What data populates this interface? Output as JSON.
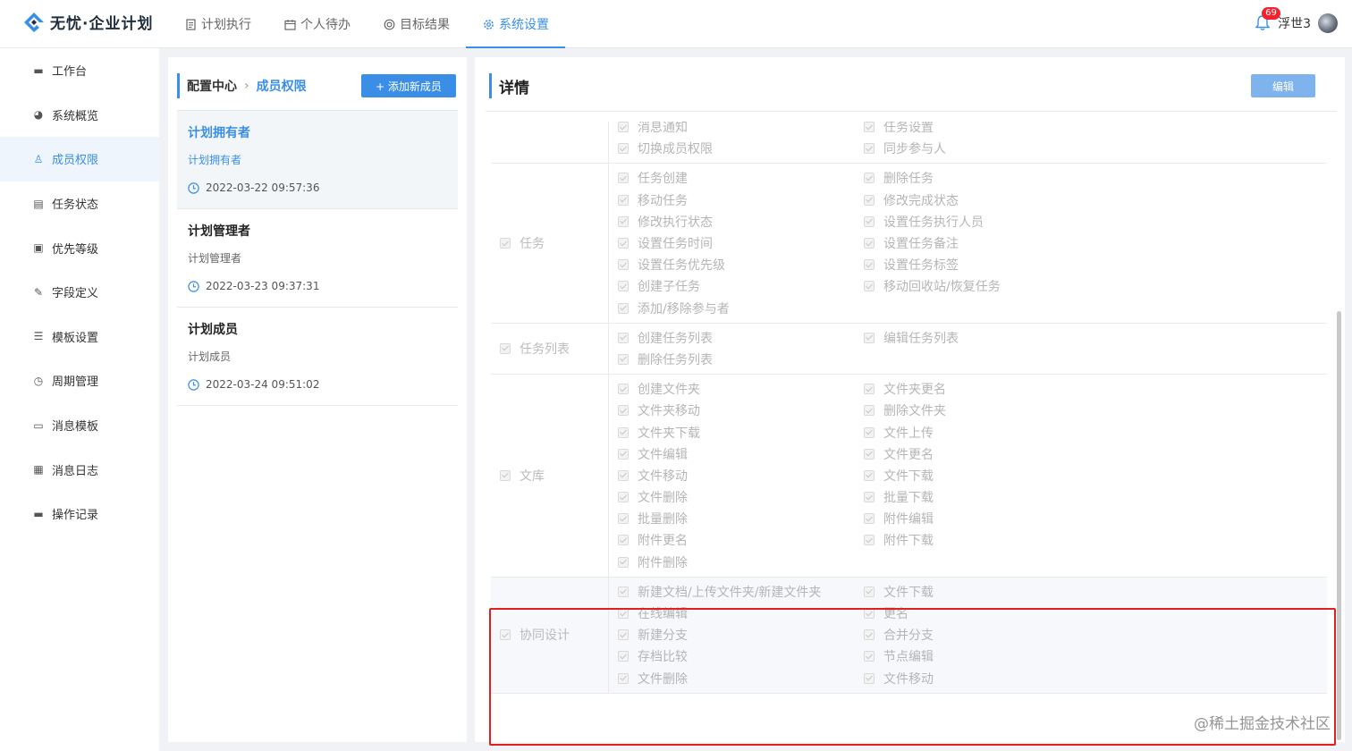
{
  "app": {
    "title": "无忧·企业计划",
    "logo_icon": "diamond-logo-icon"
  },
  "nav": [
    {
      "label": "计划执行",
      "icon": "document-icon",
      "active": false
    },
    {
      "label": "个人待办",
      "icon": "calendar-icon",
      "active": false
    },
    {
      "label": "目标结果",
      "icon": "target-icon",
      "active": false
    },
    {
      "label": "系统设置",
      "icon": "gear-icon",
      "active": true
    }
  ],
  "user": {
    "notification_count": "69",
    "name": "浮世3"
  },
  "sidebar": {
    "items": [
      {
        "label": "工作台",
        "icon": "monitor-icon",
        "glyph": "▬",
        "active": false
      },
      {
        "label": "系统概览",
        "icon": "palette-icon",
        "glyph": "◕",
        "active": false
      },
      {
        "label": "成员权限",
        "icon": "users-icon",
        "glyph": "♙",
        "active": true
      },
      {
        "label": "任务状态",
        "icon": "task-icon",
        "glyph": "▤",
        "active": false
      },
      {
        "label": "优先等级",
        "icon": "calendar-check-icon",
        "glyph": "▣",
        "active": false
      },
      {
        "label": "字段定义",
        "icon": "pen-icon",
        "glyph": "✎",
        "active": false
      },
      {
        "label": "模板设置",
        "icon": "list-icon",
        "glyph": "☰",
        "active": false
      },
      {
        "label": "周期管理",
        "icon": "clock-icon",
        "glyph": "◷",
        "active": false
      },
      {
        "label": "消息模板",
        "icon": "message-icon",
        "glyph": "▭",
        "active": false
      },
      {
        "label": "消息日志",
        "icon": "clipboard-icon",
        "glyph": "▦",
        "active": false
      },
      {
        "label": "操作记录",
        "icon": "monitor-icon",
        "glyph": "▬",
        "active": false
      }
    ]
  },
  "middle": {
    "breadcrumb": {
      "root": "配置中心",
      "current": "成员权限"
    },
    "add_button": "+ 添加新成员",
    "roles": [
      {
        "title": "计划拥有者",
        "subtitle": "计划拥有者",
        "time": "2022-03-22 09:57:36",
        "active": true
      },
      {
        "title": "计划管理者",
        "subtitle": "计划管理者",
        "time": "2022-03-23 09:37:31",
        "active": false
      },
      {
        "title": "计划成员",
        "subtitle": "计划成员",
        "time": "2022-03-24 09:51:02",
        "active": false
      }
    ]
  },
  "detail": {
    "title": "详情",
    "edit_button": "编辑",
    "groups": [
      {
        "label": "",
        "items": [
          "消息通知",
          "任务设置",
          "切换成员权限",
          "同步参与人"
        ],
        "highlight": false
      },
      {
        "label": "任务",
        "items": [
          "任务创建",
          "删除任务",
          "移动任务",
          "修改完成状态",
          "修改执行状态",
          "设置任务执行人员",
          "设置任务时间",
          "设置任务备注",
          "设置任务优先级",
          "设置任务标签",
          "创建子任务",
          "移动回收站/恢复任务",
          "添加/移除参与者"
        ],
        "highlight": false
      },
      {
        "label": "任务列表",
        "items": [
          "创建任务列表",
          "编辑任务列表",
          "删除任务列表"
        ],
        "highlight": false
      },
      {
        "label": "文库",
        "items": [
          "创建文件夹",
          "文件夹更名",
          "文件夹移动",
          "删除文件夹",
          "文件夹下载",
          "文件上传",
          "文件编辑",
          "文件更名",
          "文件移动",
          "文件下载",
          "文件删除",
          "批量下载",
          "批量删除",
          "附件编辑",
          "附件更名",
          "附件下载",
          "附件删除"
        ],
        "highlight": false
      },
      {
        "label": "协同设计",
        "items": [
          "新建文档/上传文件夹/新建文件夹",
          "文件下载",
          "在线编辑",
          "更名",
          "新建分支",
          "合并分支",
          "存档比较",
          "节点编辑",
          "文件删除",
          "文件移动"
        ],
        "highlight": true
      }
    ]
  },
  "watermark": "@稀土掘金技术社区",
  "colors": {
    "accent": "#3a8ee6",
    "highlight_border": "#e02020"
  }
}
